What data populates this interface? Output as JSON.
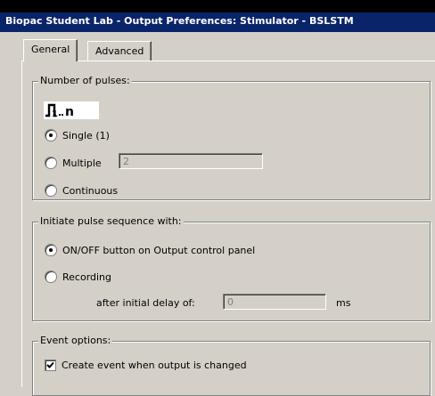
{
  "window": {
    "title": "Biopac Student Lab - Output Preferences: Stimulator - BSLSTM"
  },
  "tabs": [
    {
      "label": "General",
      "active": true
    },
    {
      "label": "Advanced",
      "active": false
    }
  ],
  "pulses": {
    "legend": "Number of pulses:",
    "icon": "pulse-train-icon",
    "options": [
      {
        "label": "Single (1)",
        "checked": true
      },
      {
        "label": "Multiple",
        "checked": false
      },
      {
        "label": "Continuous",
        "checked": false
      }
    ],
    "multiple_value": "2"
  },
  "initiate": {
    "legend": "Initiate pulse sequence with:",
    "options": [
      {
        "label": "ON/OFF button on Output control panel",
        "checked": true
      },
      {
        "label": "Recording",
        "checked": false
      }
    ],
    "delay_label": "after initial delay of:",
    "delay_value": "0",
    "delay_unit": "ms"
  },
  "events": {
    "legend": "Event options:",
    "checkbox_label": "Create event when output is changed",
    "checked": true
  }
}
